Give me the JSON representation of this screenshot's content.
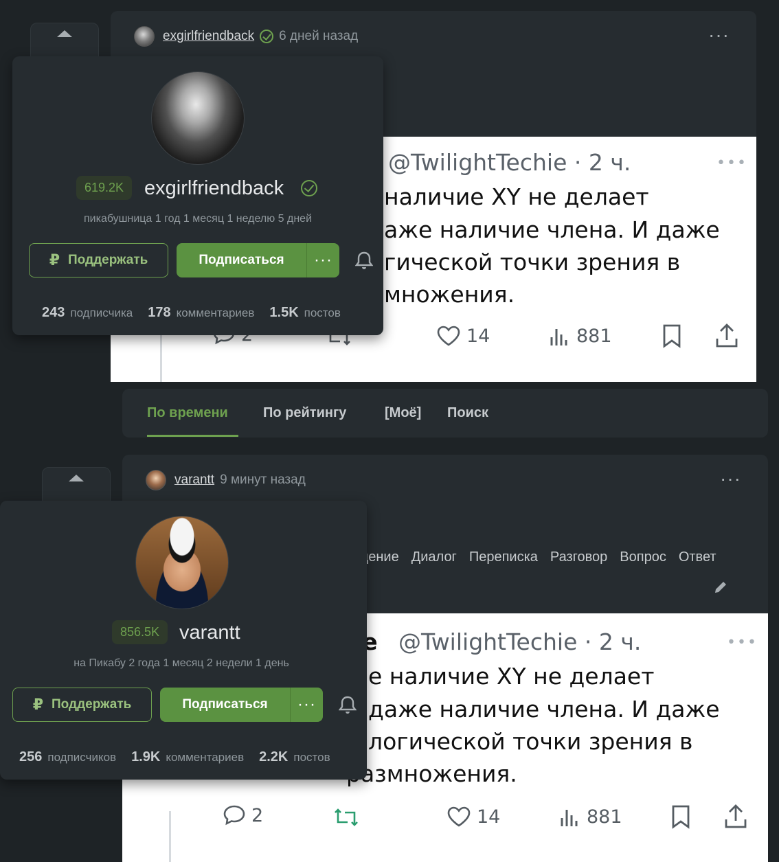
{
  "story1": {
    "author": "exgirlfriendback",
    "time": "6 дней назад",
    "tweet": {
      "handle": "@TwilightTechie · 2 ч.",
      "lines": [
        "наличие XY не делает",
        "аже наличие члена. И даже",
        "гической точки зрения в",
        "множения."
      ],
      "replies": "2",
      "likes": "14",
      "views": "881"
    }
  },
  "story2": {
    "author": "varantt",
    "time": "9 минут назад",
    "tags": [
      "щение",
      "Диалог",
      "Переписка",
      "Разговор",
      "Вопрос",
      "Ответ"
    ],
    "tweet": {
      "handle_prefix": "ie",
      "handle": "@TwilightTechie · 2 ч.",
      "lines": [
        "е наличие XY не делает",
        "даже наличие члена. И даже",
        "логической точки зрения в",
        "размножения."
      ],
      "replies": "2",
      "likes": "14",
      "views": "881"
    }
  },
  "tabs": [
    {
      "label": "По времени",
      "active": true
    },
    {
      "label": "По рейтингу",
      "active": false
    },
    {
      "label": "[Моё]",
      "active": false
    },
    {
      "label": "Поиск",
      "active": false
    }
  ],
  "popup1": {
    "rating": "619.2K",
    "name": "exgirlfriendback",
    "subtitle": "пикабушница 1 год 1 месяц 1 неделю 5 дней",
    "support_label": "Поддержать",
    "subscribe_label": "Подписаться",
    "stats": {
      "subscribers": "243",
      "subscribers_label": "подписчика",
      "comments": "178",
      "comments_label": "комментариев",
      "posts": "1.5K",
      "posts_label": "постов"
    }
  },
  "popup2": {
    "rating": "856.5K",
    "name": "varantt",
    "subtitle": "на Пикабу 2 года 1 месяц 2 недели 1 день",
    "support_label": "Поддержать",
    "subscribe_label": "Подписаться",
    "stats": {
      "subscribers": "256",
      "subscribers_label": "подписчиков",
      "comments": "1.9K",
      "comments_label": "комментариев",
      "posts": "2.2K",
      "posts_label": "постов"
    }
  },
  "colors": {
    "background": "#1e2326",
    "card": "#262c30",
    "accent_green": "#5b9241",
    "accent_green_text": "#6ea14f"
  }
}
